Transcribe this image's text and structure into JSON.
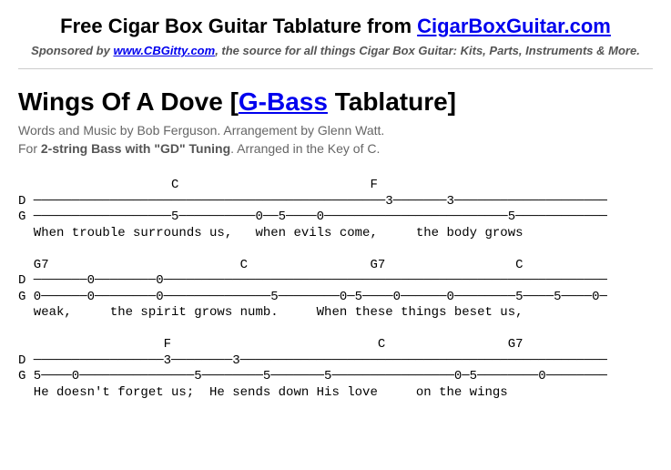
{
  "banner": {
    "prefix": "Free Cigar Box Guitar Tablature from ",
    "link_text": "CigarBoxGuitar.com"
  },
  "sponsor": {
    "prefix": "Sponsored by ",
    "link_text": "www.CBGitty.com",
    "suffix": ", the source for all things Cigar Box Guitar: Kits, Parts, Instruments & More."
  },
  "title": {
    "song": "Wings Of A Dove [",
    "link": "G-Bass",
    "after": " Tablature]"
  },
  "meta": {
    "line1": "Words and Music by Bob Ferguson. Arrangement by Glenn Watt.",
    "line2a": "For ",
    "line2b": "2-string Bass with \"GD\" Tuning",
    "line2c": ". Arranged in the Key of C."
  },
  "tab_block": "                    C                         F\nD ──────────────────────────────────────────────3───────3────────────────────\nG ──────────────────5──────────0──5────0────────────────────────5────────────\n  When trouble surrounds us,   when evils come,     the body grows\n\n  G7                         C                G7                 C\nD ───────0────────0──────────────────────────────────────────────────────────\nG 0──────0────────0──────────────5────────0─5────0──────0────────5────5────0─\n  weak,     the spirit grows numb.     When these things beset us,\n\n                   F                           C                G7\nD ─────────────────3────────3────────────────────────────────────────────────\nG 5────0───────────────5────────5───────5────────────────0─5────────0────────\n  He doesn't forget us;  He sends down His love     on the wings"
}
